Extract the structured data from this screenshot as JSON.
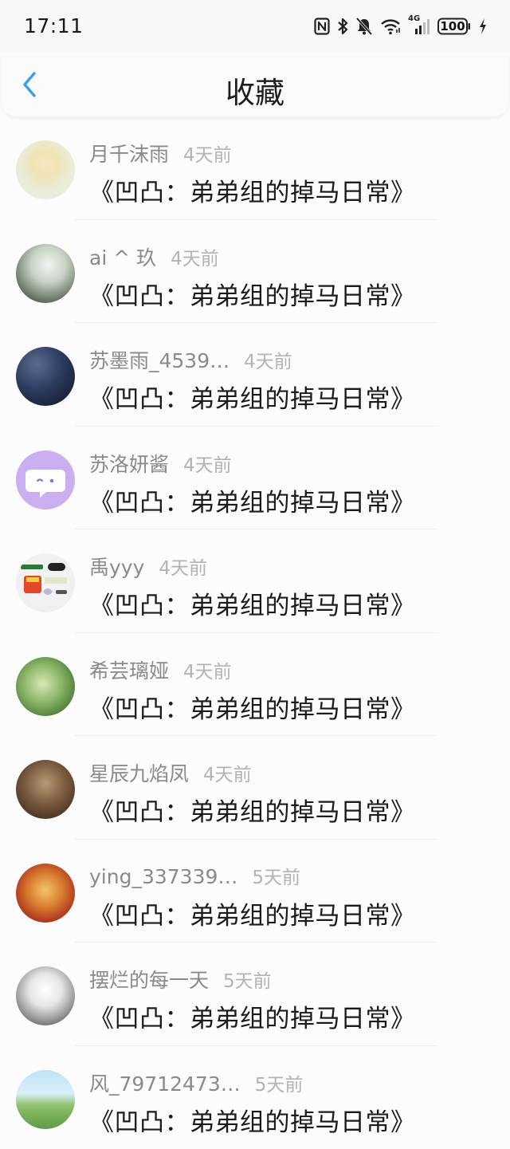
{
  "status_bar": {
    "time": "17:11",
    "battery": "100",
    "network": "4G",
    "icons": [
      "nfc-icon",
      "bluetooth-icon",
      "bell-off-icon",
      "wifi-icon",
      "signal-icon",
      "battery-icon",
      "charging-icon"
    ]
  },
  "header": {
    "title": "收藏",
    "back_icon": "chevron-left-icon",
    "accent_color": "#3a9ee8"
  },
  "list": [
    {
      "user": "月千沫雨",
      "time": "4天前",
      "title": "《凹凸：弟弟组的掉马日常》"
    },
    {
      "user": "ai ^ 玖",
      "time": "4天前",
      "title": "《凹凸：弟弟组的掉马日常》"
    },
    {
      "user": "苏墨雨_4539…",
      "time": "4天前",
      "title": "《凹凸：弟弟组的掉马日常》"
    },
    {
      "user": "苏洛妍酱",
      "time": "4天前",
      "title": "《凹凸：弟弟组的掉马日常》"
    },
    {
      "user": "禹yyy",
      "time": "4天前",
      "title": "《凹凸：弟弟组的掉马日常》"
    },
    {
      "user": "希芸璃娅",
      "time": "4天前",
      "title": "《凹凸：弟弟组的掉马日常》"
    },
    {
      "user": "星辰九焰凤",
      "time": "4天前",
      "title": "《凹凸：弟弟组的掉马日常》"
    },
    {
      "user": "ying_337339…",
      "time": "5天前",
      "title": "《凹凸：弟弟组的掉马日常》"
    },
    {
      "user": "摆烂的每一天",
      "time": "5天前",
      "title": "《凹凸：弟弟组的掉马日常》"
    },
    {
      "user": "风_79712473…",
      "time": "5天前",
      "title": "《凹凸：弟弟组的掉马日常》"
    }
  ]
}
